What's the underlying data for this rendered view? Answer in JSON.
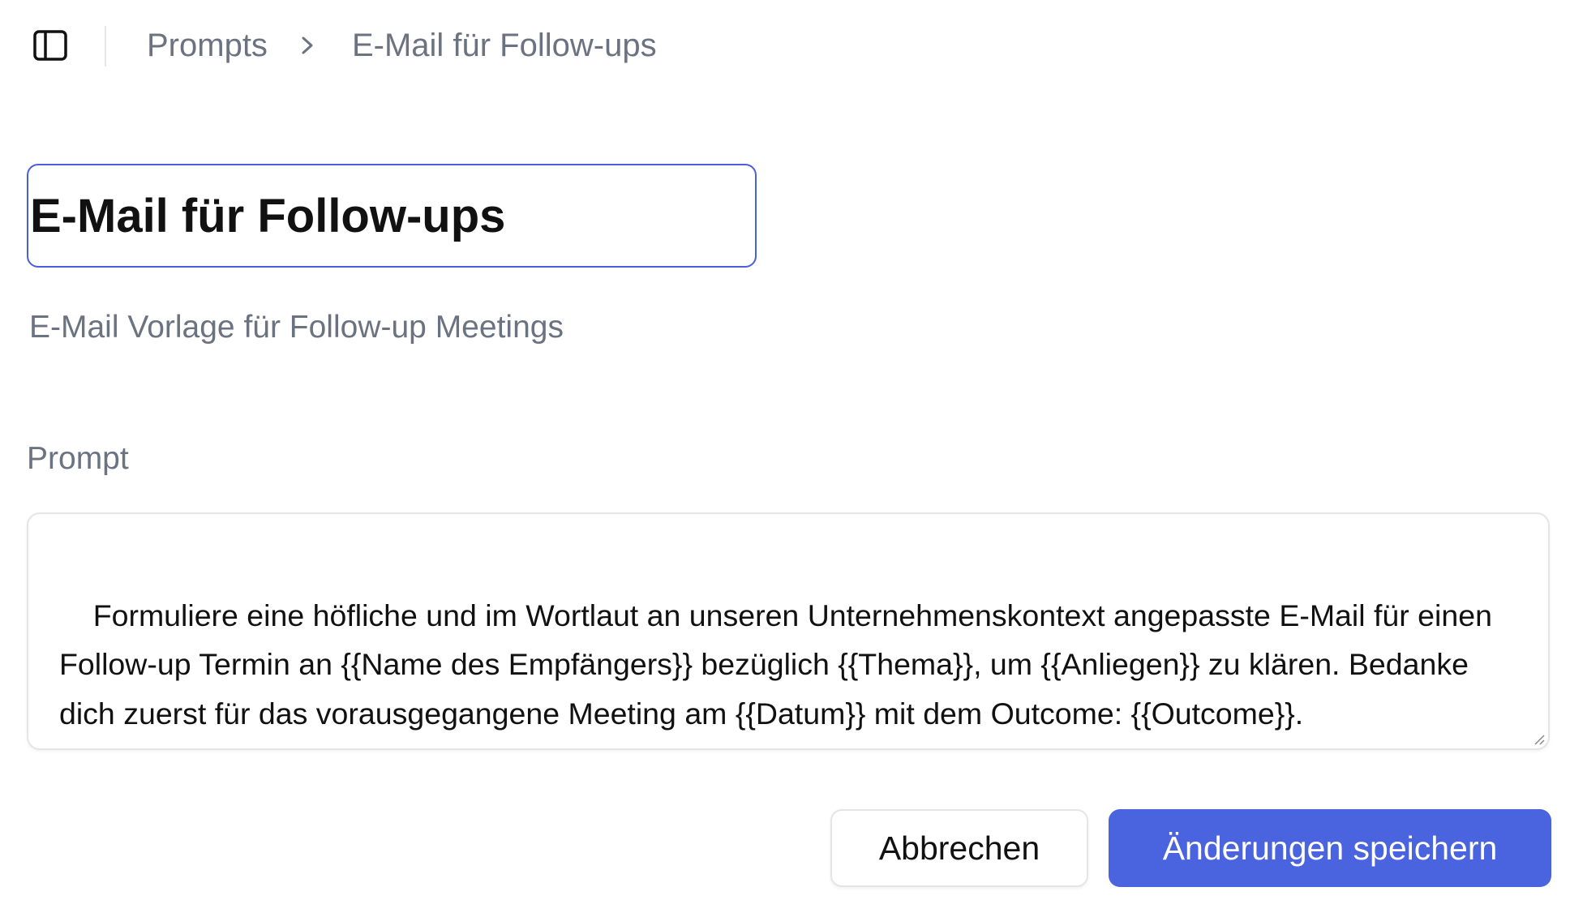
{
  "header": {
    "sidebar_toggle_icon": "sidebar-panel-icon",
    "breadcrumb": {
      "root": "Prompts",
      "separator_icon": "chevron-right-icon",
      "current": "E-Mail für Follow-ups"
    }
  },
  "form": {
    "title_value": "E-Mail für Follow-ups",
    "description": "E-Mail Vorlage für Follow-up Meetings",
    "prompt_label": "Prompt",
    "prompt_value": "Formuliere eine höfliche und im Wortlaut an unseren Unternehmenskontext angepasste E-Mail für einen Follow-up Termin an {{Name des Empfängers}} bezüglich {{Thema}}, um {{Anliegen}} zu klären. Bedanke dich zuerst für das vorausgegangene Meeting am {{Datum}} mit dem Outcome: {{Outcome}}."
  },
  "actions": {
    "cancel_label": "Abbrechen",
    "save_label": "Änderungen speichern"
  },
  "colors": {
    "accent": "#4a63df",
    "input_focus_border": "#4a5ee0",
    "muted_text": "#6b7280"
  }
}
